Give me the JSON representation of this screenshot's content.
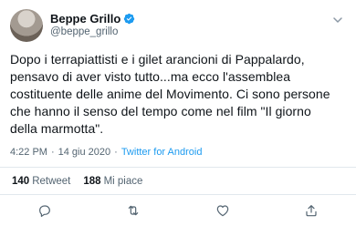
{
  "user": {
    "display_name": "Beppe Grillo",
    "handle": "@beppe_grillo"
  },
  "tweet": {
    "lines": [
      "Dopo i terrapiattisti e i gilet arancioni di Pappalardo,",
      "pensavo di aver visto tutto...ma ecco l'assemblea",
      "costituente delle anime del Movimento. Ci sono persone",
      "che hanno il senso del tempo come nel film \"Il giorno",
      "della marmotta\"."
    ],
    "time": "4:22 PM",
    "date": "14 giu 2020",
    "source": "Twitter for Android",
    "separator": "·"
  },
  "stats": {
    "retweets_count": "140",
    "retweets_label": "Retweet",
    "likes_count": "188",
    "likes_label": "Mi piace"
  },
  "colors": {
    "accent": "#1d9bf0",
    "muted": "#536471"
  },
  "icons": [
    "verified-badge-icon",
    "chevron-down-icon",
    "reply-icon",
    "retweet-icon",
    "like-icon",
    "share-icon"
  ]
}
